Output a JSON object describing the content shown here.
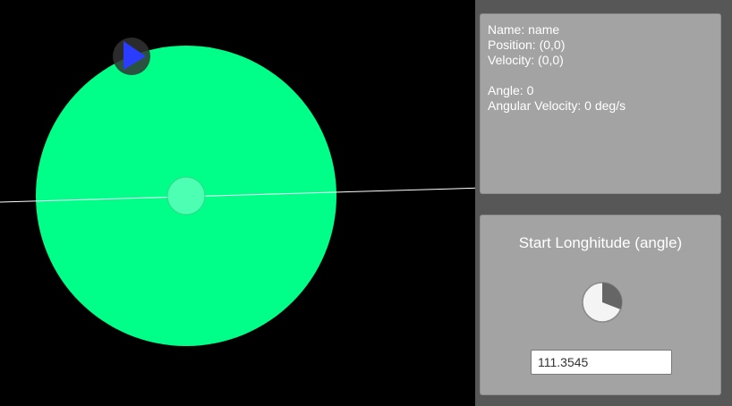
{
  "scene": {
    "planet_color": "#00ff88",
    "center_handle_color": "#4dffb2",
    "marker_color": "#2a3dff",
    "marker_bubble_color": "#333333",
    "horizon_line_color": "#ffffff",
    "marker_icon": "play-triangle-icon"
  },
  "info": {
    "name": "Name: name",
    "position": "Position: (0,0)",
    "velocity": "Velocity: (0,0)",
    "angle": "Angle: 0",
    "angular_velocity": "Angular Velocity: 0 deg/s"
  },
  "longitude": {
    "title": "Start Longhitude (angle)",
    "value": "111.3545",
    "angle_degrees": 111.3545
  }
}
